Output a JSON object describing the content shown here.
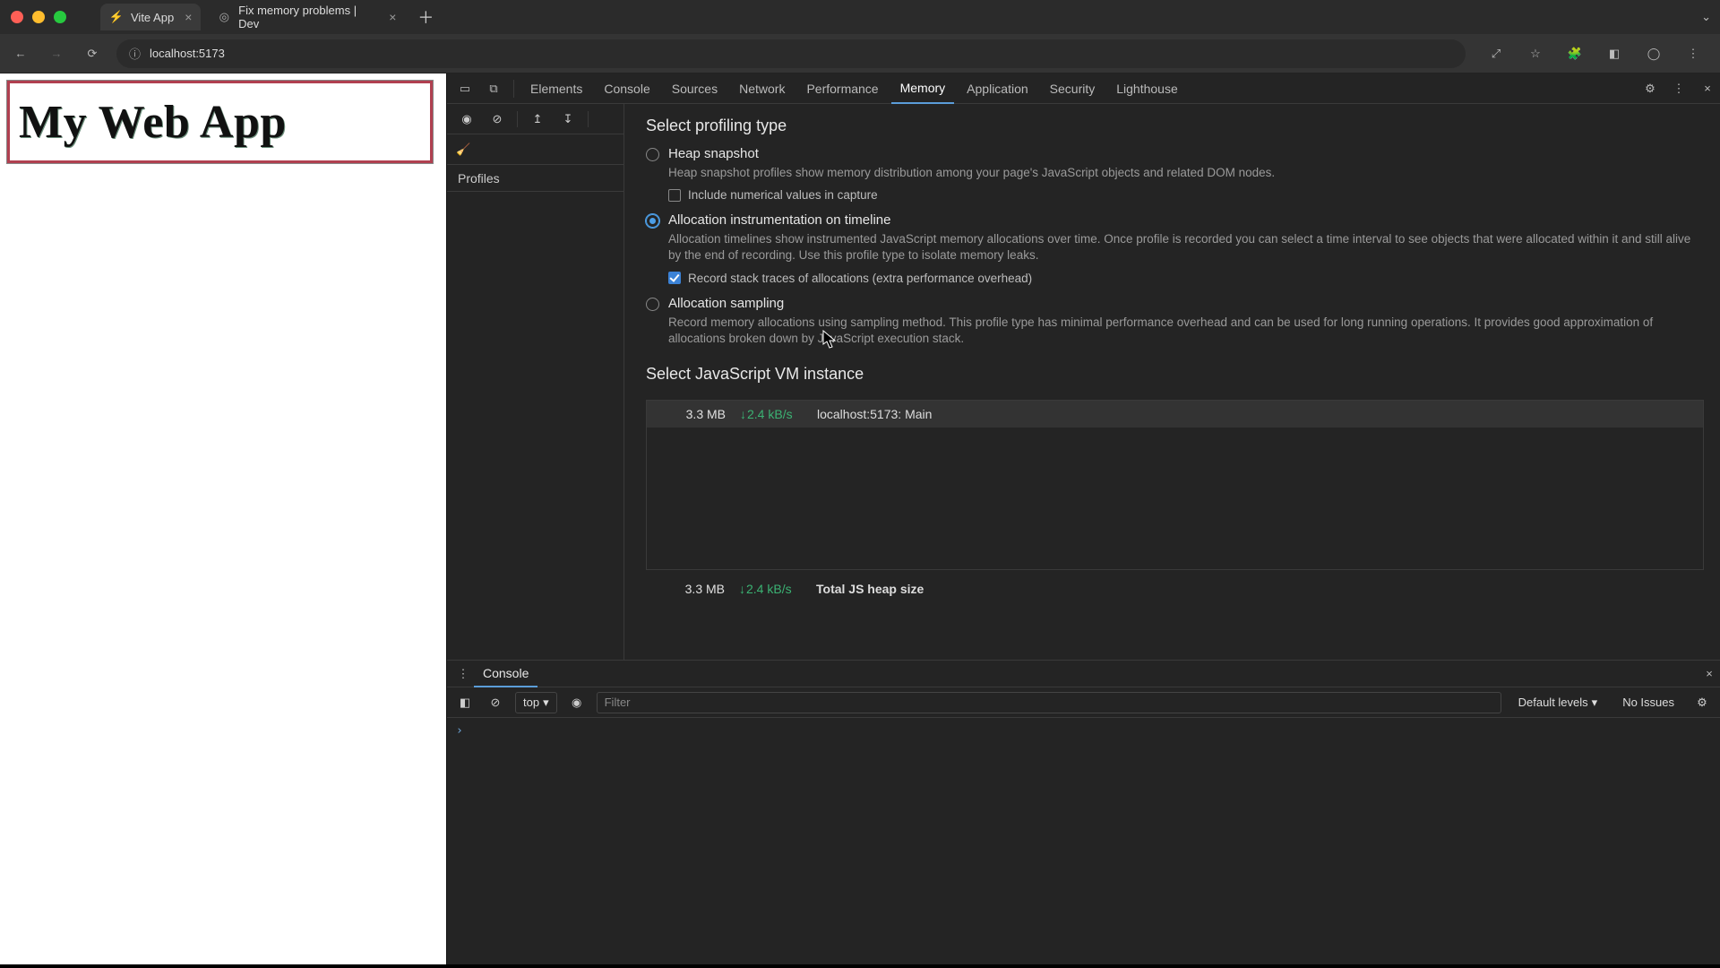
{
  "browser": {
    "tabs": [
      {
        "title": "Vite App",
        "active": true
      },
      {
        "title": "Fix memory problems  |  Dev",
        "active": false
      }
    ],
    "url": "localhost:5173"
  },
  "page": {
    "heading": "My Web App"
  },
  "devtools": {
    "tabs": [
      "Elements",
      "Console",
      "Sources",
      "Network",
      "Performance",
      "Memory",
      "Application",
      "Security",
      "Lighthouse"
    ],
    "active_tab": "Memory",
    "left": {
      "profiles_label": "Profiles"
    },
    "memory": {
      "select_profiling_title": "Select profiling type",
      "options": [
        {
          "title": "Heap snapshot",
          "desc": "Heap snapshot profiles show memory distribution among your page's JavaScript objects and related DOM nodes.",
          "selected": false,
          "sub": {
            "label": "Include numerical values in capture",
            "checked": false
          }
        },
        {
          "title": "Allocation instrumentation on timeline",
          "desc": "Allocation timelines show instrumented JavaScript memory allocations over time. Once profile is recorded you can select a time interval to see objects that were allocated within it and still alive by the end of recording. Use this profile type to isolate memory leaks.",
          "selected": true,
          "sub": {
            "label": "Record stack traces of allocations (extra performance overhead)",
            "checked": true
          }
        },
        {
          "title": "Allocation sampling",
          "desc": "Record memory allocations using sampling method. This profile type has minimal performance overhead and can be used for long running operations. It provides good approximation of allocations broken down by JavaScript execution stack.",
          "selected": false
        }
      ],
      "vm_title": "Select JavaScript VM instance",
      "vm_instances": [
        {
          "size": "3.3 MB",
          "rate": "2.4 kB/s",
          "name": "localhost:5173: Main"
        }
      ],
      "vm_total": {
        "size": "3.3 MB",
        "rate": "2.4 kB/s",
        "label": "Total JS heap size"
      }
    },
    "drawer": {
      "tab": "Console",
      "context": "top",
      "filter_placeholder": "Filter",
      "levels": "Default levels",
      "issues": "No Issues"
    }
  }
}
